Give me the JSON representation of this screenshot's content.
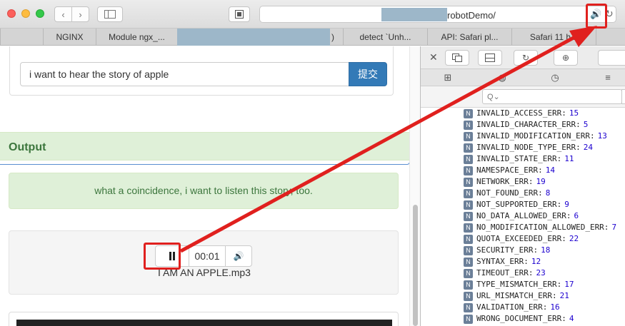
{
  "browser": {
    "address_text": "robotDemo/",
    "tabs": [
      "NGINX",
      "Module ngx_...",
      ")",
      "detect `Unh...",
      "API: Safari pl...",
      "Safari 11 h..."
    ]
  },
  "page": {
    "question_value": "i want to hear the story of apple",
    "submit_label": "提交",
    "output_heading": "Output",
    "answer_text": "what a coincidence, i want to listen this story, too.",
    "player": {
      "time": "00:01",
      "track_name": "I AM AN APPLE.mp3"
    }
  },
  "inspector": {
    "filter_placeholder": "Q⌄",
    "badge_label": "N",
    "properties": [
      {
        "name": "INVALID_ACCESS_ERR:",
        "value": "15"
      },
      {
        "name": "INVALID_CHARACTER_ERR:",
        "value": "5"
      },
      {
        "name": "INVALID_MODIFICATION_ERR:",
        "value": "13"
      },
      {
        "name": "INVALID_NODE_TYPE_ERR:",
        "value": "24"
      },
      {
        "name": "INVALID_STATE_ERR:",
        "value": "11"
      },
      {
        "name": "NAMESPACE_ERR:",
        "value": "14"
      },
      {
        "name": "NETWORK_ERR:",
        "value": "19"
      },
      {
        "name": "NOT_FOUND_ERR:",
        "value": "8"
      },
      {
        "name": "NOT_SUPPORTED_ERR:",
        "value": "9"
      },
      {
        "name": "NO_DATA_ALLOWED_ERR:",
        "value": "6"
      },
      {
        "name": "NO_MODIFICATION_ALLOWED_ERR:",
        "value": "7"
      },
      {
        "name": "QUOTA_EXCEEDED_ERR:",
        "value": "22"
      },
      {
        "name": "SECURITY_ERR:",
        "value": "18"
      },
      {
        "name": "SYNTAX_ERR:",
        "value": "12"
      },
      {
        "name": "TIMEOUT_ERR:",
        "value": "23"
      },
      {
        "name": "TYPE_MISMATCH_ERR:",
        "value": "17"
      },
      {
        "name": "URL_MISMATCH_ERR:",
        "value": "21"
      },
      {
        "name": "VALIDATION_ERR:",
        "value": "16"
      },
      {
        "name": "WRONG_DOCUMENT_ERR:",
        "value": "4"
      }
    ]
  },
  "colors": {
    "annotation_red": "#e0201e",
    "submit_blue": "#337ab7",
    "success_green": "#3c763d"
  }
}
